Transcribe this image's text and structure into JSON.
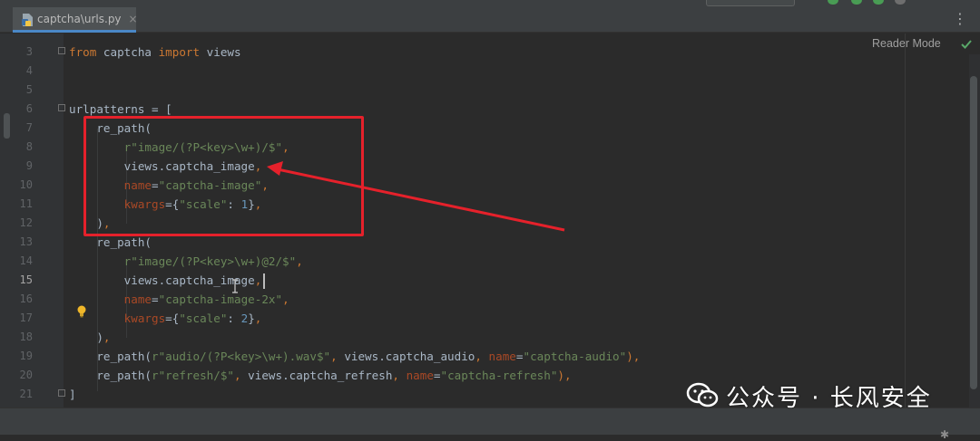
{
  "editor": {
    "tab": {
      "label": "captcha\\urls.py",
      "close": "×"
    },
    "tabs_menu": "⋮",
    "reader_mode": "Reader Mode",
    "current_line": 15
  },
  "gutter": {
    "line_numbers": [
      "3",
      "4",
      "5",
      "6",
      "7",
      "8",
      "9",
      "10",
      "11",
      "12",
      "13",
      "14",
      "15",
      "16",
      "17",
      "18",
      "19",
      "20",
      "21"
    ]
  },
  "code_lines": [
    [
      {
        "t": "from",
        "c": "kw"
      },
      {
        "t": " captcha "
      },
      {
        "t": "import",
        "c": "kw"
      },
      {
        "t": " views"
      }
    ],
    [],
    [],
    [
      {
        "t": "urlpatterns = ["
      }
    ],
    [
      {
        "t": "    re_path("
      }
    ],
    [
      {
        "t": "        "
      },
      {
        "t": "r\"image/(?P<key>\\w+)/$\"",
        "c": "str"
      },
      {
        "t": ",",
        "c": "kw"
      }
    ],
    [
      {
        "t": "        views.captcha_image"
      },
      {
        "t": ",",
        "c": "kw"
      }
    ],
    [
      {
        "t": "        "
      },
      {
        "t": "name",
        "c": "param"
      },
      {
        "t": "="
      },
      {
        "t": "\"captcha-image\"",
        "c": "str"
      },
      {
        "t": ",",
        "c": "kw"
      }
    ],
    [
      {
        "t": "        "
      },
      {
        "t": "kwargs",
        "c": "param"
      },
      {
        "t": "={"
      },
      {
        "t": "\"scale\"",
        "c": "str"
      },
      {
        "t": ": "
      },
      {
        "t": "1",
        "c": "num"
      },
      {
        "t": "}"
      },
      {
        "t": ",",
        "c": "kw"
      }
    ],
    [
      {
        "t": "    )"
      },
      {
        "t": ",",
        "c": "kw"
      }
    ],
    [
      {
        "t": "    re_path("
      }
    ],
    [
      {
        "t": "        "
      },
      {
        "t": "r\"image/(?P<key>\\w+)@2/$\"",
        "c": "str"
      },
      {
        "t": ",",
        "c": "kw"
      }
    ],
    [
      {
        "t": "        views.captcha_image"
      },
      {
        "t": ",",
        "c": "kw"
      }
    ],
    [
      {
        "t": "        "
      },
      {
        "t": "name",
        "c": "param"
      },
      {
        "t": "="
      },
      {
        "t": "\"captcha-image-2x\"",
        "c": "str"
      },
      {
        "t": ",",
        "c": "kw"
      }
    ],
    [
      {
        "t": "        "
      },
      {
        "t": "kwargs",
        "c": "param"
      },
      {
        "t": "={"
      },
      {
        "t": "\"scale\"",
        "c": "str"
      },
      {
        "t": ": "
      },
      {
        "t": "2",
        "c": "num"
      },
      {
        "t": "}"
      },
      {
        "t": ",",
        "c": "kw"
      }
    ],
    [
      {
        "t": "    )"
      },
      {
        "t": ",",
        "c": "kw"
      }
    ],
    [
      {
        "t": "    re_path("
      },
      {
        "t": "r\"audio/(?P<key>\\w+).wav$\"",
        "c": "str"
      },
      {
        "t": ", ",
        "c": "kw"
      },
      {
        "t": "views.captcha_audio"
      },
      {
        "t": ", ",
        "c": "kw"
      },
      {
        "t": "name",
        "c": "param"
      },
      {
        "t": "="
      },
      {
        "t": "\"captcha-audio\"",
        "c": "str"
      },
      {
        "t": "),",
        "c": "kw"
      }
    ],
    [
      {
        "t": "    re_path("
      },
      {
        "t": "r\"refresh/$\"",
        "c": "str"
      },
      {
        "t": ", ",
        "c": "kw"
      },
      {
        "t": "views.captcha_refresh"
      },
      {
        "t": ", ",
        "c": "kw"
      },
      {
        "t": "name",
        "c": "param"
      },
      {
        "t": "="
      },
      {
        "t": "\"captcha-refresh\"",
        "c": "str"
      },
      {
        "t": "),",
        "c": "kw"
      }
    ],
    [
      {
        "t": "]"
      }
    ]
  ],
  "watermark": {
    "text": "公众号 · 长风安全"
  },
  "colors": {
    "keyword": "#cc7832",
    "string": "#6a8759",
    "number": "#6897bb",
    "parameter": "#aa4926",
    "annotation_red": "#e5212b",
    "tab_underline": "#4a88c7"
  }
}
